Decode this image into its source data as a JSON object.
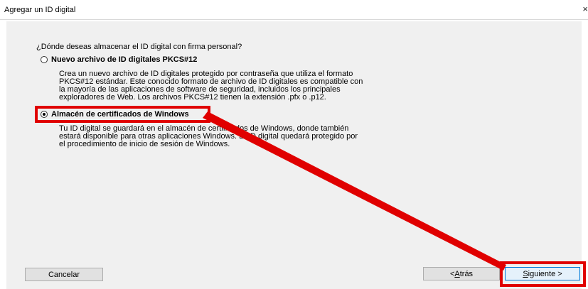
{
  "window": {
    "title": "Agregar un ID digital",
    "close_glyph": "×"
  },
  "main": {
    "question": "¿Dónde deseas almacenar el ID digital con firma personal?",
    "options": [
      {
        "label": "Nuevo archivo de ID digitales PKCS#12",
        "selected": false,
        "description_lines": [
          "Crea un nuevo archivo de ID digitales protegido por contraseña que utiliza el formato",
          "PKCS#12 estándar. Este conocido formato de archivo de ID digitales es compatible con",
          "la mayoría de las aplicaciones de software de seguridad, incluidos los principales",
          "exploradores de Web. Los archivos PKCS#12 tienen la extensión .pfx o .p12."
        ]
      },
      {
        "label": "Almacén de certificados de Windows",
        "selected": true,
        "description_lines": [
          "Tu ID digital se guardará en el almacén de certificados de Windows, donde también",
          "estará disponible para otras aplicaciones Windows. El ID digital quedará protegido por",
          "el procedimiento de inicio de sesión de Windows."
        ]
      }
    ]
  },
  "buttons": {
    "cancel": "Cancelar",
    "back_prefix": "< ",
    "back_mnemonic": "A",
    "back_rest": "trás",
    "next_mnemonic": "S",
    "next_rest": "iguiente >"
  },
  "annotation": {
    "color": "#e00000"
  }
}
